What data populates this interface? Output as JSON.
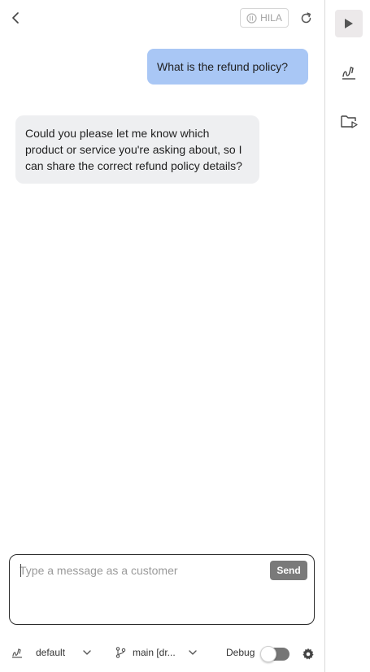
{
  "header": {
    "hila_label": "HILA"
  },
  "messages": [
    {
      "role": "user",
      "text": "What is the refund policy?"
    },
    {
      "role": "assistant",
      "text": "Could you please let me know which product or service you're asking about, so I can share the correct refund policy details?"
    }
  ],
  "composer": {
    "placeholder": "Type a message as a customer",
    "value": "",
    "send_label": "Send"
  },
  "footer": {
    "persona": "default",
    "branch": "main [dr...",
    "debug_label": "Debug",
    "debug_on": false
  },
  "rail": {
    "icons": [
      "play-icon",
      "sign-icon",
      "folder-play-icon"
    ]
  },
  "colors": {
    "user_bubble": "#a9c7f5",
    "assistant_bubble": "#eeeff1",
    "send_button": "#7a7a7a"
  }
}
